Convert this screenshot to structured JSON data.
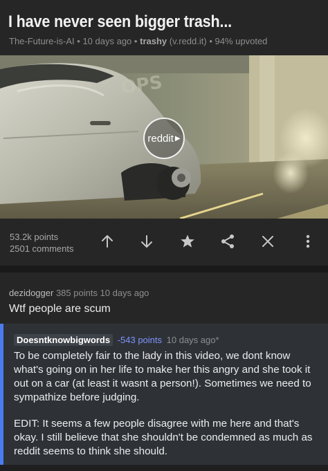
{
  "post": {
    "title": "I have never seen bigger trash...",
    "author": "The-Future-is-AI",
    "age": "10 days ago",
    "subreddit": "trashy",
    "domain": "(v.redd.it)",
    "upvoted": "94% upvoted",
    "sep": "•"
  },
  "media": {
    "sign_text": "OPS",
    "badge_label": "reddit",
    "badge_play": "▶"
  },
  "stats": {
    "points": "53.2k points",
    "comments": "2501 comments"
  },
  "actions": [
    {
      "name": "upvote-icon"
    },
    {
      "name": "downvote-icon"
    },
    {
      "name": "star-icon"
    },
    {
      "name": "share-icon"
    },
    {
      "name": "close-icon"
    },
    {
      "name": "more-vertical-icon"
    }
  ],
  "comments": [
    {
      "author": "dezidogger",
      "points": "385 points",
      "age": "10 days ago",
      "body": "Wtf people are scum"
    },
    {
      "author": "Doesntknowbigwords",
      "points": "-543 points",
      "age": "10 days ago*",
      "body_p1": "To be completely fair to the lady in this video, we dont know what's going on in her life to make her this angry and she took it out on a car (at least it wasnt a person!). Sometimes we need to sympathize before judging.",
      "body_p2": "EDIT: It seems a few people disagree with me here and that's okay. I still believe that she shouldn't be condemned as much as reddit seems to think she should.",
      "indent_color": "#4a7cf0"
    }
  ],
  "colors": {
    "score_negative": "#7f94ff",
    "background": "#1f1f1f",
    "panel": "#262626"
  }
}
